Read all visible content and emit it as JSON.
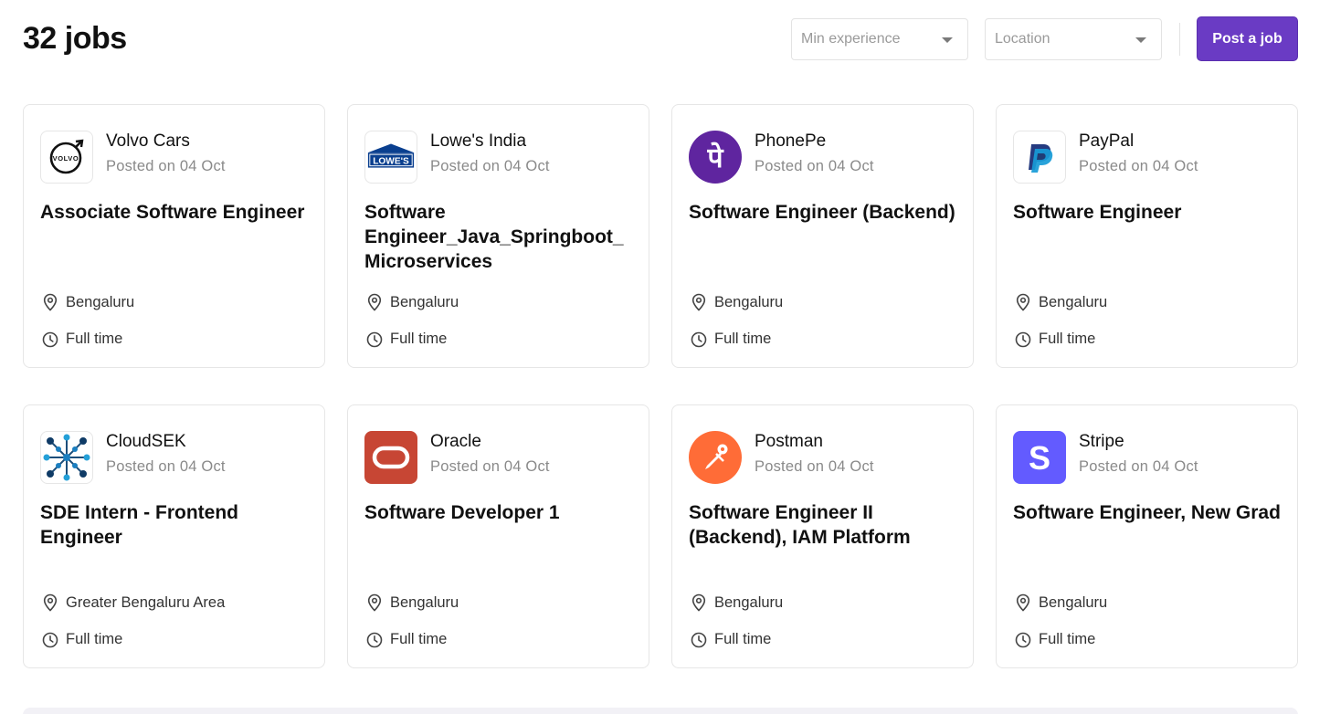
{
  "header": {
    "job_count": "32 jobs",
    "min_experience_placeholder": "Min experience",
    "location_placeholder": "Location",
    "post_job_label": "Post a job"
  },
  "colors": {
    "accent": "#6a3bc4"
  },
  "jobs": [
    {
      "company": "Volvo Cars",
      "posted": "Posted on 04 Oct",
      "title": "Associate Software Engineer",
      "location": "Bengaluru",
      "type": "Full time",
      "logo": "volvo-logo-icon"
    },
    {
      "company": "Lowe's India",
      "posted": "Posted on 04 Oct",
      "title": "Software Engineer_Java_Springboot_ Microservices",
      "location": "Bengaluru",
      "type": "Full time",
      "logo": "lowes-logo-icon",
      "logo_text": "LOWE'S"
    },
    {
      "company": "PhonePe",
      "posted": "Posted on 04 Oct",
      "title": "Software Engineer (Backend)",
      "location": "Bengaluru",
      "type": "Full time",
      "logo": "phonepe-logo-icon",
      "logo_text": "पे"
    },
    {
      "company": "PayPal",
      "posted": "Posted on 04 Oct",
      "title": "Software Engineer",
      "location": "Bengaluru",
      "type": "Full time",
      "logo": "paypal-logo-icon"
    },
    {
      "company": "CloudSEK",
      "posted": "Posted on 04 Oct",
      "title": "SDE Intern - Frontend Engineer",
      "location": "Greater Bengaluru Area",
      "type": "Full time",
      "logo": "cloudsek-logo-icon"
    },
    {
      "company": "Oracle",
      "posted": "Posted on 04 Oct",
      "title": "Software Developer 1",
      "location": "Bengaluru",
      "type": "Full time",
      "logo": "oracle-logo-icon"
    },
    {
      "company": "Postman",
      "posted": "Posted on 04 Oct",
      "title": "Software Engineer II (Backend), IAM Platform",
      "location": "Bengaluru",
      "type": "Full time",
      "logo": "postman-logo-icon"
    },
    {
      "company": "Stripe",
      "posted": "Posted on 04 Oct",
      "title": "Software Engineer, New Grad",
      "location": "Bengaluru",
      "type": "Full time",
      "logo": "stripe-logo-icon",
      "logo_text": "S"
    }
  ]
}
